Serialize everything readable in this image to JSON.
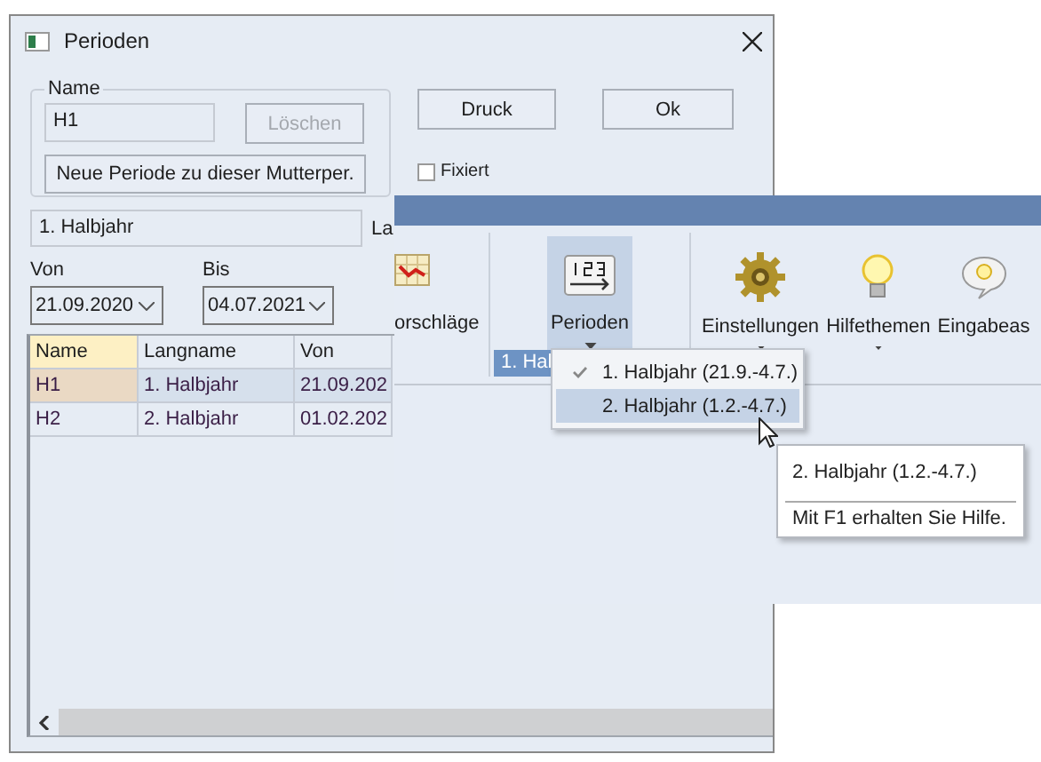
{
  "dialog": {
    "title": "Perioden",
    "name_group": {
      "legend": "Name",
      "value": "H1",
      "delete_button": {
        "label": "Löschen",
        "disabled": true
      },
      "new_button": "Neue Periode zu dieser Mutterper."
    },
    "print_button": "Druck",
    "ok_button": "Ok",
    "fixed_checkbox": {
      "label": "Fixiert",
      "checked": false
    },
    "longname_field": {
      "value": "1. Halbjahr"
    },
    "longname_label": "La",
    "from": {
      "label": "Von",
      "value": "21.09.2020"
    },
    "to": {
      "label": "Bis",
      "value": "04.07.2021"
    },
    "table": {
      "columns": [
        {
          "label": "Name",
          "sorted": true
        },
        {
          "label": "Langname",
          "sorted": false
        },
        {
          "label": "Von",
          "sorted": false
        }
      ],
      "rows": [
        {
          "cells": [
            "H1",
            "1. Halbjahr",
            "21.09.202"
          ],
          "selected": true
        },
        {
          "cells": [
            "H2",
            "2. Halbjahr",
            "01.02.202"
          ],
          "selected": false
        }
      ]
    }
  },
  "ribbon": {
    "items": [
      {
        "label": "orschläge",
        "kind": "chart",
        "dropdown": false,
        "selected": false
      },
      {
        "label": "Perioden",
        "kind": "period",
        "dropdown": true,
        "selected": true
      },
      {
        "label": "Einstellungen",
        "kind": "gear",
        "dropdown": true,
        "selected": false
      },
      {
        "label": "Hilfethemen",
        "kind": "bulb",
        "dropdown": true,
        "selected": false
      },
      {
        "label": "Eingabeas",
        "kind": "bubble",
        "dropdown": false,
        "selected": false
      }
    ],
    "status": "1. Hal"
  },
  "menu": {
    "items": [
      {
        "label": "1. Halbjahr (21.9.-4.7.)",
        "checked": true,
        "selected": false
      },
      {
        "label": "2. Halbjahr (1.2.-4.7.)",
        "checked": false,
        "selected": true
      }
    ]
  },
  "tooltip": {
    "title": "2. Halbjahr (1.2.-4.7.)",
    "hint": "Mit F1 erhalten Sie Hilfe."
  }
}
